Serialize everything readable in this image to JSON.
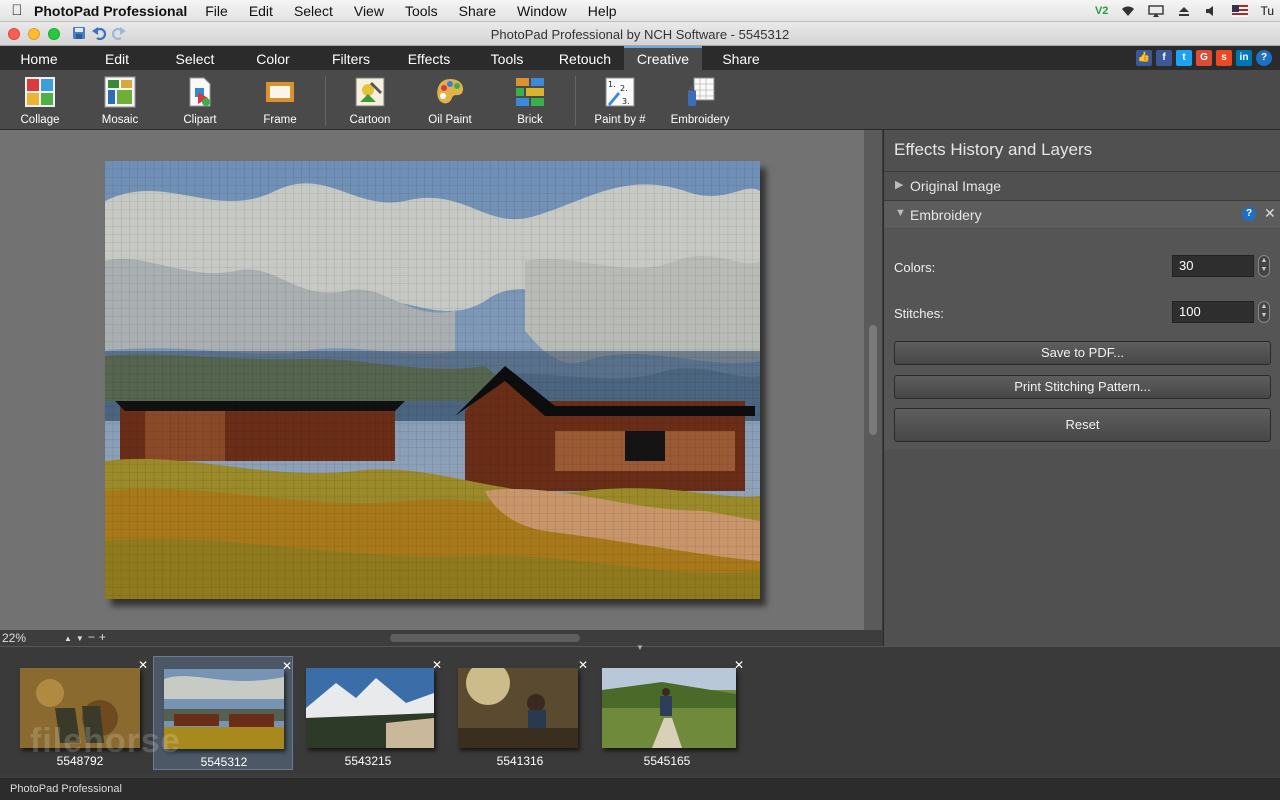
{
  "macmenu": {
    "app_name": "PhotoPad Professional",
    "items": [
      "File",
      "Edit",
      "Select",
      "View",
      "Tools",
      "Share",
      "Window",
      "Help"
    ],
    "tray_text": "Tu"
  },
  "window": {
    "title": "PhotoPad Professional by NCH Software - 5545312"
  },
  "ribbon": {
    "tabs": [
      "Home",
      "Edit",
      "Select",
      "Color",
      "Filters",
      "Effects",
      "Tools",
      "Retouch",
      "Creative",
      "Share"
    ],
    "active_tab": "Creative"
  },
  "toolbar": {
    "tools": [
      "Collage",
      "Mosaic",
      "Clipart",
      "Frame",
      "Cartoon",
      "Oil Paint",
      "Brick",
      "Paint by #",
      "Embroidery"
    ]
  },
  "canvas": {
    "zoom": "22%"
  },
  "panel": {
    "title": "Effects History and Layers",
    "original_label": "Original Image",
    "effect_label": "Embroidery",
    "colors_label": "Colors:",
    "colors_value": "30",
    "stitches_label": "Stitches:",
    "stitches_value": "100",
    "save_pdf": "Save to PDF...",
    "print_pattern": "Print Stitching Pattern...",
    "reset": "Reset"
  },
  "filmstrip": [
    {
      "label": "5548792"
    },
    {
      "label": "5545312"
    },
    {
      "label": "5543215"
    },
    {
      "label": "5541316"
    },
    {
      "label": "5545165"
    }
  ],
  "status": {
    "text": "PhotoPad Professional"
  },
  "watermark": "filehorse"
}
